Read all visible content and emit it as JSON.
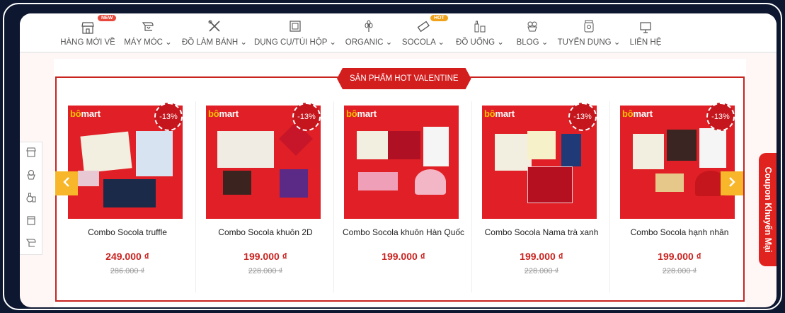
{
  "nav": {
    "items": [
      {
        "label": "HÀNG MỚI VỀ",
        "icon": "store-icon",
        "badge": "NEW"
      },
      {
        "label": "MÁY MÓC",
        "icon": "stand-mixer-icon",
        "dropdown": true
      },
      {
        "label": "ĐỒ LÀM BÁNH",
        "icon": "baking-tools-icon",
        "dropdown": true
      },
      {
        "label": "DỤNG CỤ/TÚI HỘP",
        "icon": "box-icon",
        "dropdown": true
      },
      {
        "label": "ORGANIC",
        "icon": "wheat-icon",
        "dropdown": true
      },
      {
        "label": "SOCOLA",
        "icon": "chocolate-bar-icon",
        "dropdown": true,
        "badge": "HOT"
      },
      {
        "label": "ĐỒ UỐNG",
        "icon": "bottles-icon",
        "dropdown": true
      },
      {
        "label": "BLOG",
        "icon": "cupcake-icon",
        "dropdown": true
      },
      {
        "label": "TUYỂN DỤNG",
        "icon": "jar-icon",
        "dropdown": true
      },
      {
        "label": "LIÊN HỆ",
        "icon": "computer-icon"
      }
    ]
  },
  "section": {
    "title": "SẢN PHẨM HOT VALENTINE"
  },
  "products": [
    {
      "name": "Combo Socola truffle",
      "price": "249.000 ₫",
      "old_price": "286.000 ₫",
      "discount": "-13%",
      "logo_a": "bô",
      "logo_b": "mart"
    },
    {
      "name": "Combo Socola khuôn 2D",
      "price": "199.000 ₫",
      "old_price": "228.000 ₫",
      "discount": "-13%",
      "logo_a": "bô",
      "logo_b": "mart"
    },
    {
      "name": "Combo Socola khuôn Hàn Quốc",
      "price": "199.000 ₫",
      "old_price": "",
      "discount": "",
      "logo_a": "bô",
      "logo_b": "mart"
    },
    {
      "name": "Combo Socola Nama trà xanh",
      "price": "199.000 ₫",
      "old_price": "228.000 ₫",
      "discount": "-13%",
      "logo_a": "bô",
      "logo_b": "mart"
    },
    {
      "name": "Combo Socola hạnh nhân",
      "price": "199.000 ₫",
      "old_price": "228.000 ₫",
      "discount": "-13%",
      "logo_a": "bô",
      "logo_b": "mart"
    }
  ],
  "sidebar": {
    "icons": [
      "store-icon",
      "cupcake-icon",
      "bottles-icon",
      "box-icon",
      "stand-mixer-icon"
    ]
  },
  "coupon": {
    "label": "Coupon Khuyến Mại"
  },
  "colors": {
    "accent": "#d31e1e",
    "arrow": "#f8b62a",
    "product_bg": "#e02026",
    "background": "#0d1730"
  }
}
